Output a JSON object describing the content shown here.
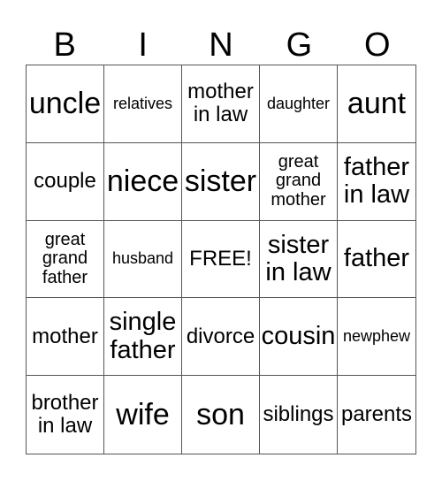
{
  "header": [
    "B",
    "I",
    "N",
    "G",
    "O"
  ],
  "cells": [
    {
      "text": "uncle",
      "size": "s-xl"
    },
    {
      "text": "relatives",
      "size": "s-xs"
    },
    {
      "text": "mother in law",
      "size": "s-m"
    },
    {
      "text": "daughter",
      "size": "s-xs"
    },
    {
      "text": "aunt",
      "size": "s-xl"
    },
    {
      "text": "couple",
      "size": "s-m"
    },
    {
      "text": "niece",
      "size": "s-xl"
    },
    {
      "text": "sister",
      "size": "s-xl"
    },
    {
      "text": "great grand mother",
      "size": "s-s"
    },
    {
      "text": "father in law",
      "size": "s-l"
    },
    {
      "text": "great grand father",
      "size": "s-s"
    },
    {
      "text": "husband",
      "size": "s-xs"
    },
    {
      "text": "FREE!",
      "size": "s-m"
    },
    {
      "text": "sister in law",
      "size": "s-l"
    },
    {
      "text": "father",
      "size": "s-l"
    },
    {
      "text": "mother",
      "size": "s-m"
    },
    {
      "text": "single father",
      "size": "s-l"
    },
    {
      "text": "divorce",
      "size": "s-m"
    },
    {
      "text": "cousin",
      "size": "s-l"
    },
    {
      "text": "newphew",
      "size": "s-xs"
    },
    {
      "text": "brother in law",
      "size": "s-m"
    },
    {
      "text": "wife",
      "size": "s-xl"
    },
    {
      "text": "son",
      "size": "s-xl"
    },
    {
      "text": "siblings",
      "size": "s-m"
    },
    {
      "text": "parents",
      "size": "s-m"
    }
  ]
}
